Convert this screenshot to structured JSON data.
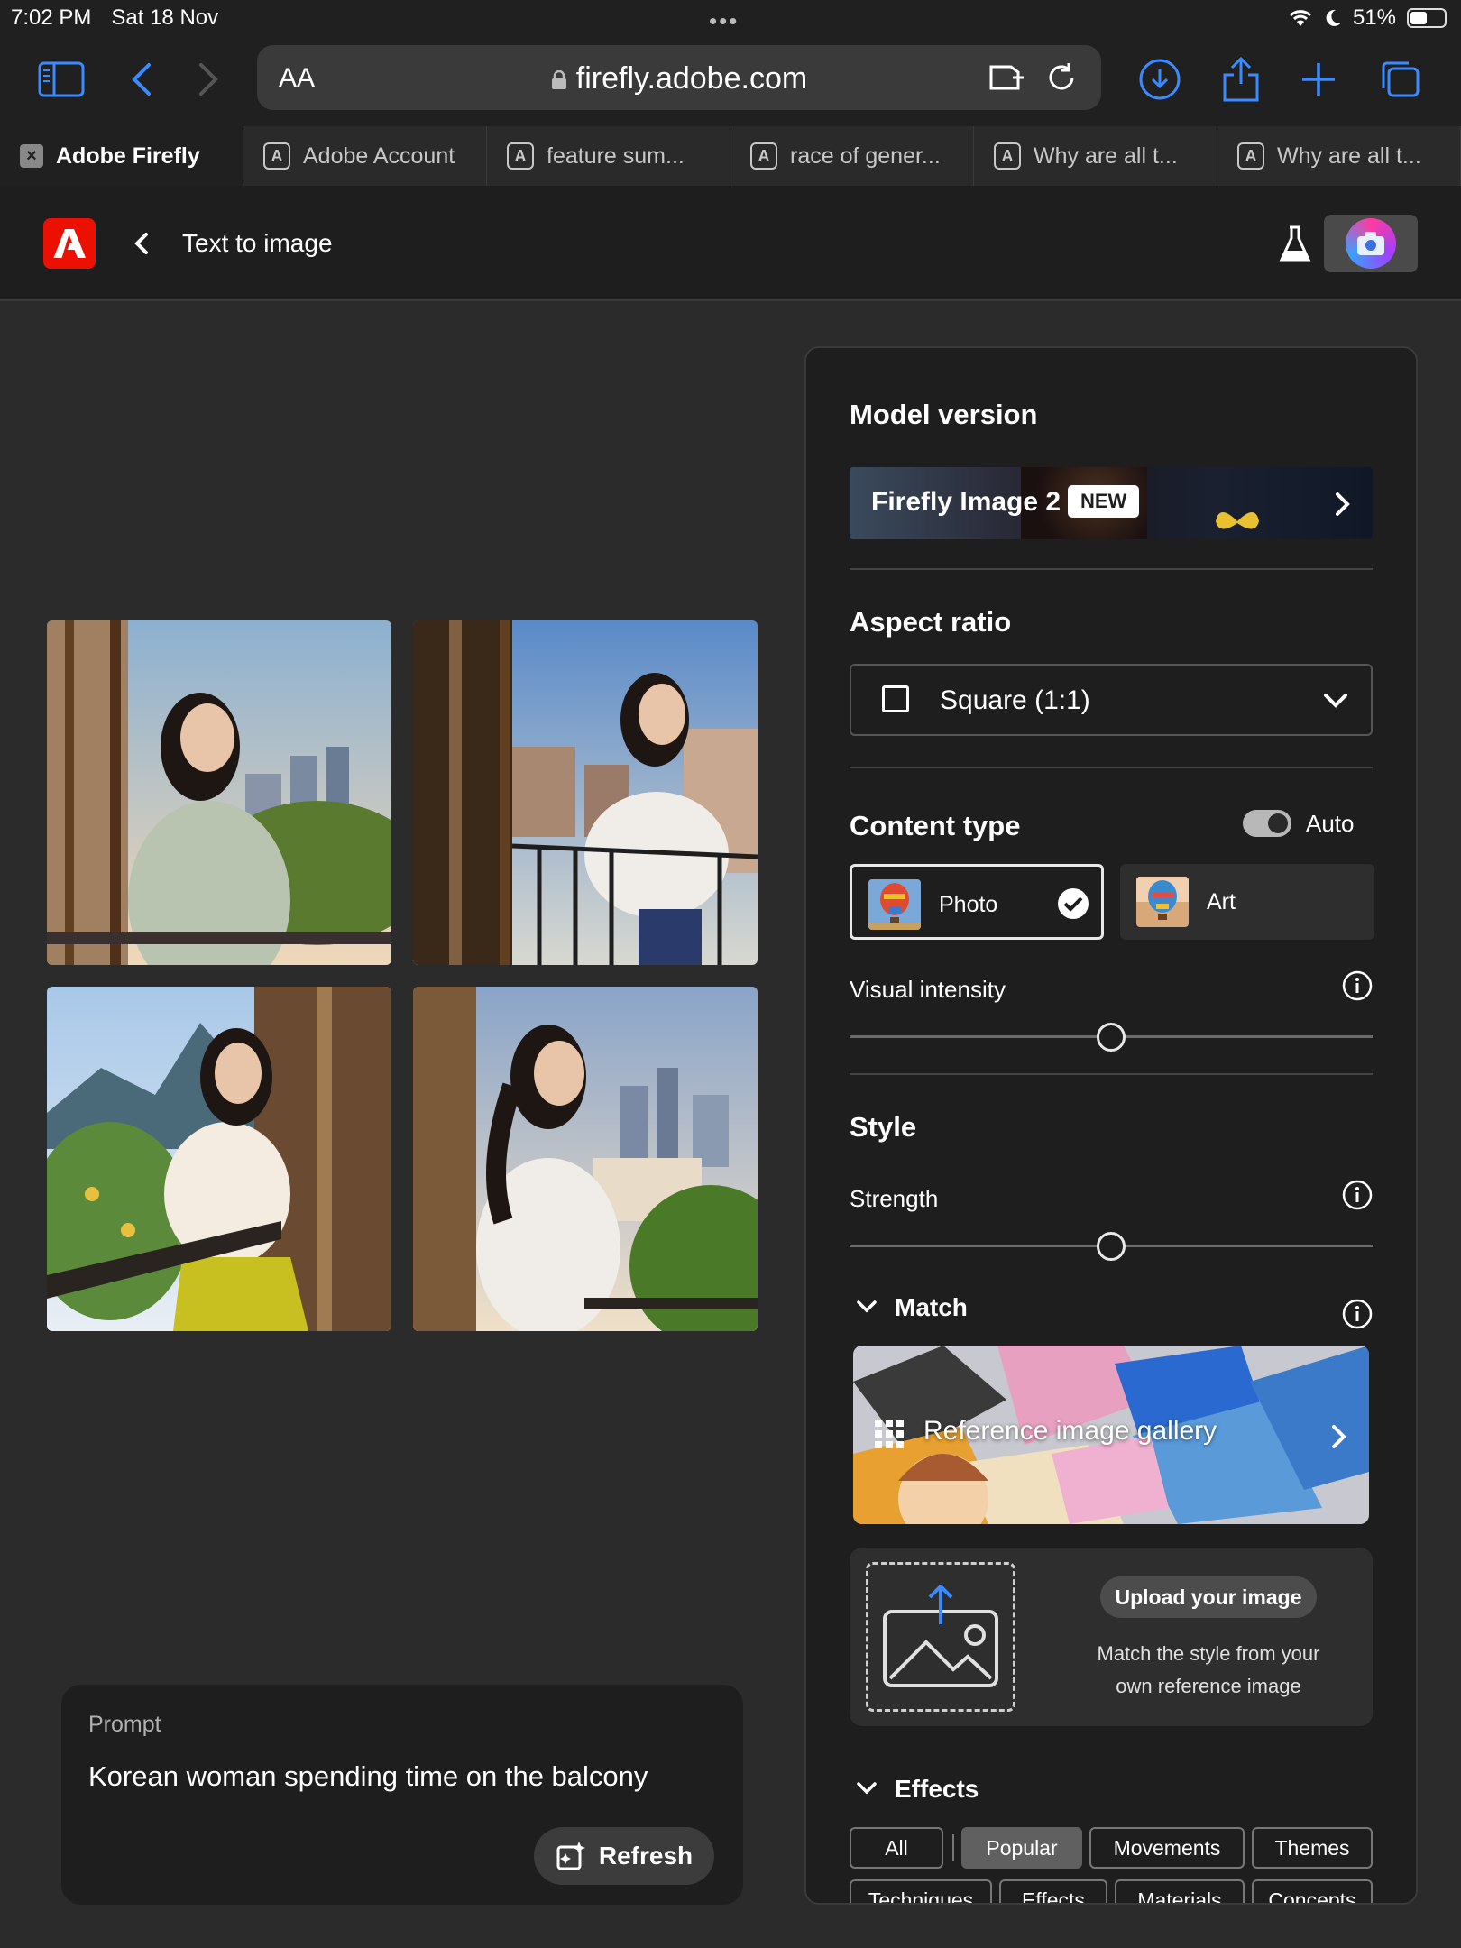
{
  "status_bar": {
    "time": "7:02 PM",
    "date": "Sat 18 Nov",
    "battery": "51%",
    "battery_level": 0.51
  },
  "browser": {
    "text_size_label": "AA",
    "url": "firefly.adobe.com",
    "tabs": [
      {
        "label": "Adobe Firefly",
        "active": true
      },
      {
        "label": "Adobe Account",
        "active": false
      },
      {
        "label": "feature sum...",
        "active": false
      },
      {
        "label": "race of gener...",
        "active": false
      },
      {
        "label": "Why are all t...",
        "active": false
      },
      {
        "label": "Why are all t...",
        "active": false
      }
    ],
    "tab_favicon_letter": "A"
  },
  "app_header": {
    "title": "Text to image"
  },
  "prompt": {
    "label": "Prompt",
    "text": "Korean woman spending time on the balcony",
    "refresh_label": "Refresh"
  },
  "panel": {
    "model_version": {
      "title": "Model version",
      "model_name": "Firefly Image 2",
      "badge": "NEW"
    },
    "aspect_ratio": {
      "title": "Aspect ratio",
      "selected": "Square (1:1)"
    },
    "content_type": {
      "title": "Content type",
      "auto_label": "Auto",
      "auto_on": true,
      "options": [
        {
          "label": "Photo",
          "selected": true
        },
        {
          "label": "Art",
          "selected": false
        }
      ]
    },
    "visual_intensity": {
      "label": "Visual intensity",
      "value": 0.5
    },
    "style": {
      "title": "Style",
      "strength_label": "Strength",
      "strength_value": 0.5
    },
    "match": {
      "title": "Match",
      "gallery_label": "Reference image gallery",
      "upload_button": "Upload your image",
      "upload_desc_line1": "Match the style from your",
      "upload_desc_line2": "own reference image"
    },
    "effects": {
      "title": "Effects",
      "chips_row1": [
        "All",
        "Popular",
        "Movements",
        "Themes"
      ],
      "chips_row2": [
        "Techniques",
        "Effects",
        "Materials",
        "Concepts"
      ],
      "active_chip": "Popular"
    }
  },
  "colors": {
    "adobe_red": "#eb1000",
    "link_blue": "#3a8bff",
    "panel_bg": "#1e1e1e",
    "page_bg": "#2b2b2b"
  }
}
